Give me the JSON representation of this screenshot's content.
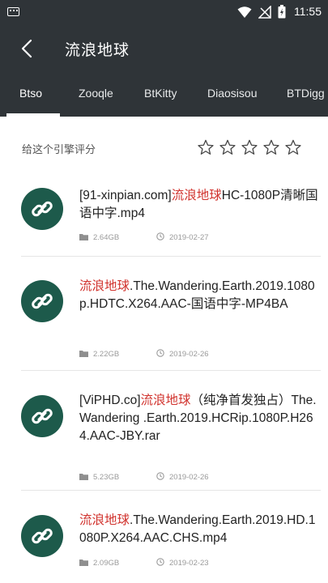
{
  "status_bar": {
    "time": "11:55"
  },
  "header": {
    "title": "流浪地球"
  },
  "tabs": [
    {
      "label": "Btso",
      "active": true
    },
    {
      "label": "Zooqle",
      "active": false
    },
    {
      "label": "BtKitty",
      "active": false
    },
    {
      "label": "Diaosisou",
      "active": false
    },
    {
      "label": "BTDigg",
      "active": false
    }
  ],
  "rating": {
    "label": "给这个引擎评分",
    "stars": 5,
    "filled": 0
  },
  "results": [
    {
      "prefix": "[91-xinpian.com]",
      "highlight": "流浪地球",
      "suffix": "HC-1080P清晰国语中字.mp4",
      "size": "2.64GB",
      "date": "2019-02-27"
    },
    {
      "prefix": "",
      "highlight": "流浪地球",
      "suffix": ".The.Wandering.Earth.2019.1080p.HDTC.X264.AAC-国语中字-MP4BA",
      "size": "2.22GB",
      "date": "2019-02-26"
    },
    {
      "prefix": "[ViPHD.co]",
      "highlight": "流浪地球",
      "suffix": "（纯净首发独占）The.Wandering .Earth.2019.HCRip.1080P.H264.AAC-JBY.rar",
      "size": "5.23GB",
      "date": "2019-02-26"
    },
    {
      "prefix": "",
      "highlight": "流浪地球",
      "suffix": ".The.Wandering.Earth.2019.HD.1080P.X264.AAC.CHS.mp4",
      "size": "2.09GB",
      "date": "2019-02-23"
    }
  ],
  "colors": {
    "bar": "#2f3438",
    "avatar": "#1d5a4b",
    "highlight": "#d1332e"
  },
  "icons": {
    "item": "link-icon",
    "size": "folder-icon",
    "date": "clock-icon"
  }
}
